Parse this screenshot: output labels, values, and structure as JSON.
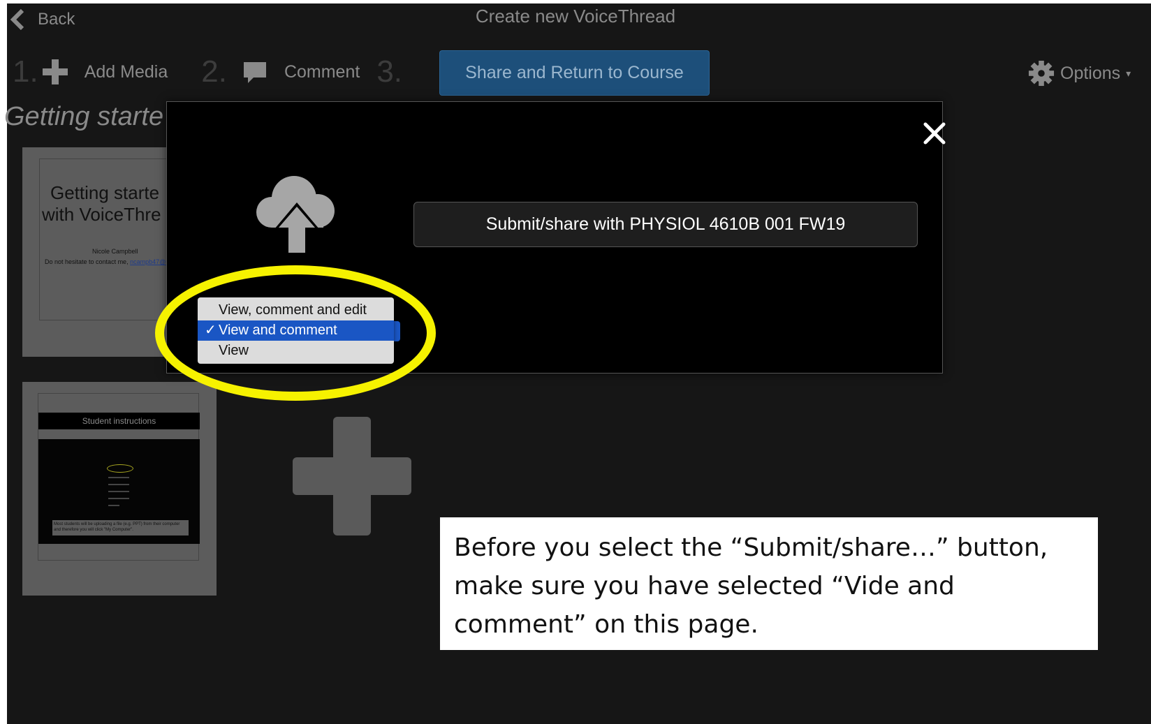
{
  "header": {
    "back_label": "Back",
    "title": "Create new VoiceThread"
  },
  "steps": [
    {
      "number": "1.",
      "icon": "plus-icon",
      "label": "Add Media"
    },
    {
      "number": "2.",
      "icon": "comment-icon",
      "label": "Comment"
    },
    {
      "number": "3.",
      "label": "Share and Return to Course"
    }
  ],
  "options_label": "Options",
  "thread_title": "Getting starte",
  "slides": {
    "slide1": {
      "title_line1": "Getting starte",
      "title_line2": "with VoiceThre",
      "author": "Nicole Campbell",
      "contact_prefix": "Do not hesitate to contact me, ",
      "contact_link": "ncampb47@u"
    },
    "slide2": {
      "header": "Student instructions",
      "note": "Most students will be uploading a file (e.g. PPT) from their computer and therefore you will click \"My Computer\"."
    }
  },
  "modal": {
    "submit_label": "Submit/share with PHYSIOL 4610B 001 FW19",
    "permission_options": [
      "View, comment and edit",
      "View and comment",
      "View"
    ],
    "selected_option": "View and comment",
    "check_mark": "✓"
  },
  "callout": {
    "text": "Before you select the “Submit/share…” button, make sure you have selected “Vide and comment” on this page."
  },
  "colors": {
    "highlight": "#f6f200",
    "selected": "#1a56c4",
    "share_button": "#1d4f7a"
  }
}
